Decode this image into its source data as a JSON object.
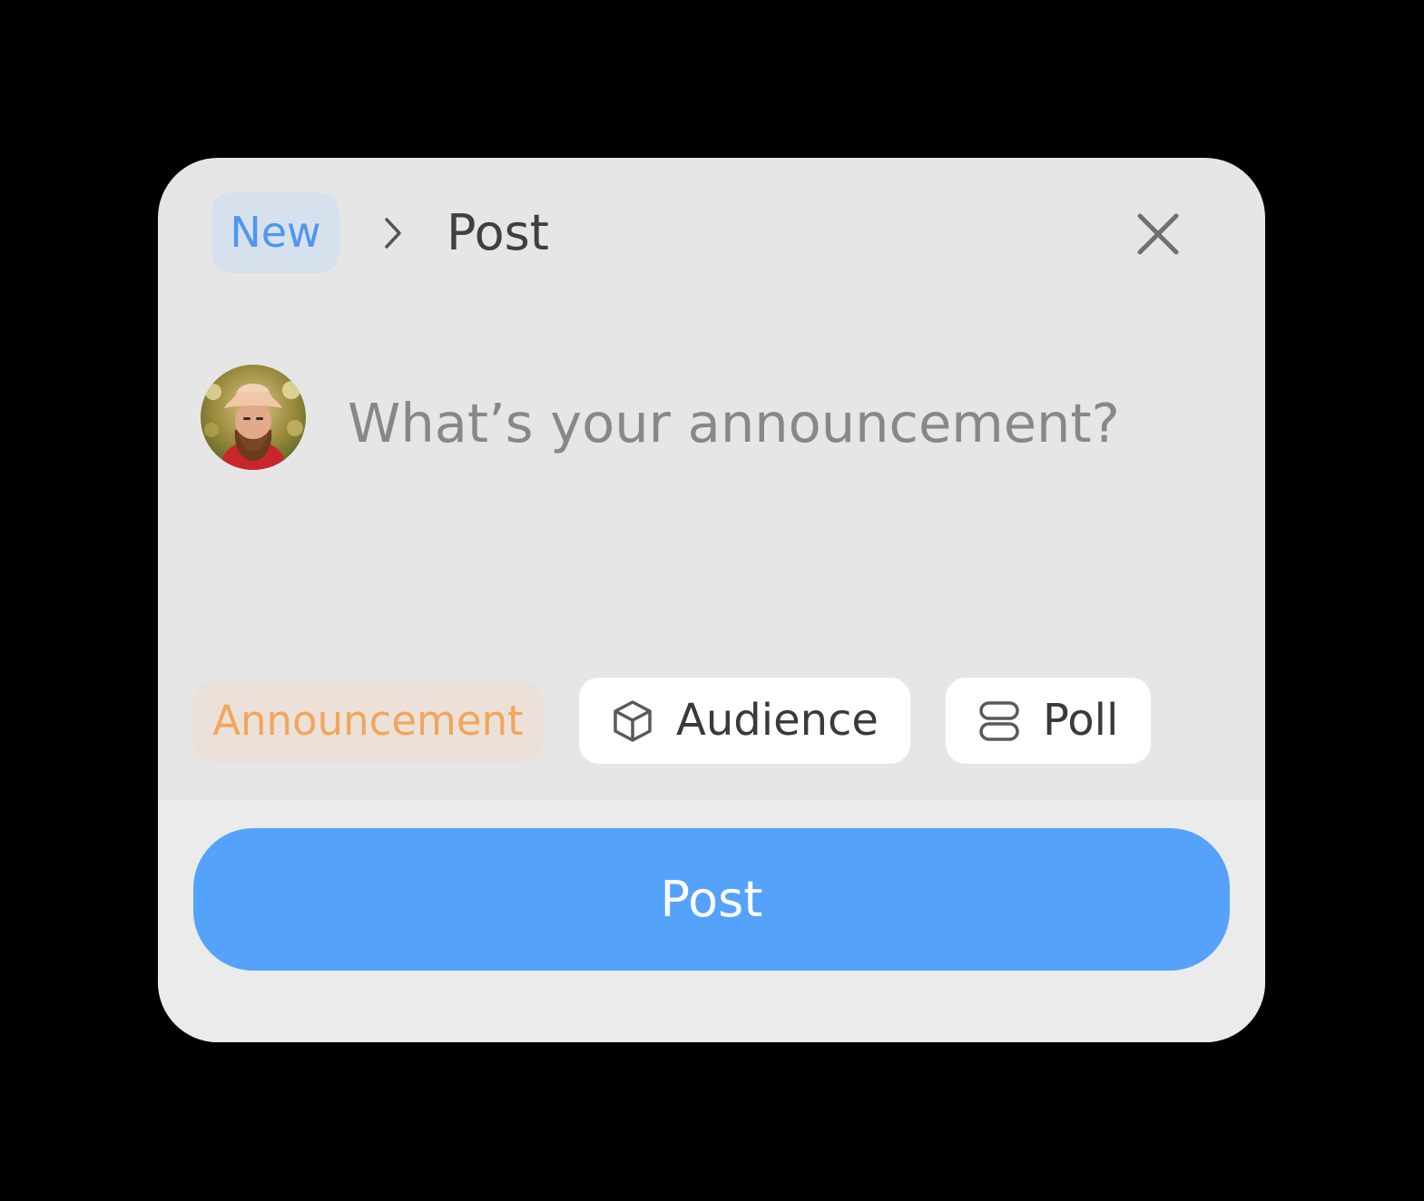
{
  "header": {
    "new_label": "New",
    "chevron_icon": "chevron-right-icon",
    "title": "Post",
    "close_icon": "close-icon"
  },
  "composer": {
    "avatar_icon": "user-avatar",
    "placeholder": "What’s your announcement?",
    "value": ""
  },
  "tags": {
    "announcement_label": "Announcement",
    "audience_label": "Audience",
    "audience_icon": "cube-icon",
    "poll_label": "Poll",
    "poll_icon": "poll-icon"
  },
  "footer": {
    "post_label": "Post"
  },
  "colors": {
    "accent_blue": "#55a2fb",
    "new_chip_bg": "#d7e1ee",
    "new_chip_text": "#4f96f1",
    "announcement_bg": "#ece1d8",
    "announcement_text": "#f2a55c",
    "card_bg": "#e6e6e6"
  }
}
